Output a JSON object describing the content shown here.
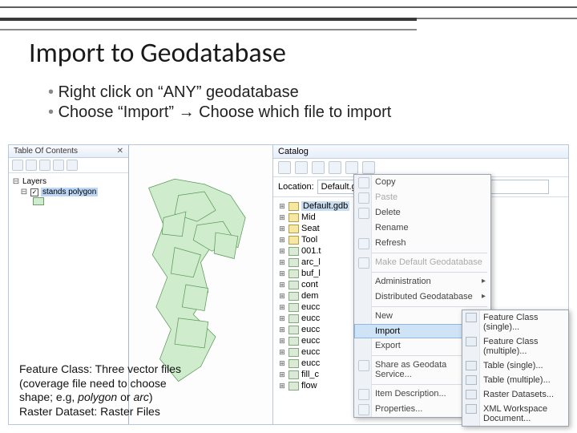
{
  "slide": {
    "title": "Import to Geodatabase",
    "bullet1": "Right click on “ANY” geodatabase",
    "bullet2_a": "Choose “Import” ",
    "bullet2_arrow": "→",
    "bullet2_b": " Choose which file to import"
  },
  "toc": {
    "title": "Table Of Contents",
    "layers_label": "Layers",
    "layer1": "stands polygon"
  },
  "catalog": {
    "title": "Catalog",
    "location_label": "Location:",
    "location_value": "Default.gdb",
    "items": {
      "i0": "Default.gdb",
      "i1": "Mid",
      "i2": "Seat",
      "i3": "Tool",
      "i4": "001.t",
      "i5": "arc_l",
      "i6": "buf_l",
      "i7": "cont",
      "i8": "dem",
      "i9": "eucc",
      "i10": "eucc",
      "i11": "eucc",
      "i12": "eucc",
      "i13": "eucc",
      "i14": "eucc",
      "i15": "fill_c",
      "i16": "flow"
    }
  },
  "ctx": {
    "copy": "Copy",
    "paste": "Paste",
    "delete": "Delete",
    "rename": "Rename",
    "refresh": "Refresh",
    "make_default": "Make Default Geodatabase",
    "admin": "Administration",
    "distributed": "Distributed Geodatabase",
    "new": "New",
    "import": "Import",
    "export": "Export",
    "share": "Share as Geodata Service...",
    "item_desc": "Item Description...",
    "properties": "Properties..."
  },
  "import_sub": {
    "fc_single": "Feature Class (single)...",
    "fc_multi": "Feature Class (multiple)...",
    "tbl_single": "Table (single)...",
    "tbl_multi": "Table (multiple)...",
    "raster": "Raster Datasets...",
    "xml": "XML Workspace Document..."
  },
  "annot": {
    "l1": "Feature Class: Three vector files",
    "l2a": "(coverage file need to choose",
    "l2b": "shape; e.g, ",
    "l2c_i": "polygon",
    "l2d": " or ",
    "l2e_i": "arc",
    "l2f": ")",
    "l3": "Raster Dataset: Raster Files"
  }
}
